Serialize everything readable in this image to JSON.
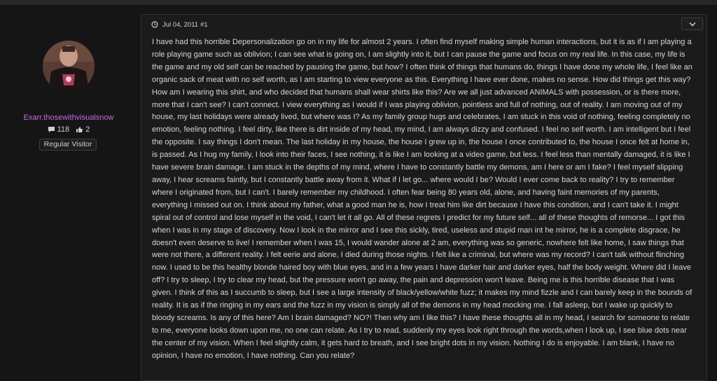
{
  "author": {
    "username": "Exarr.thosewithvisualsnow",
    "messages_count": "118",
    "likes_count": "2",
    "role": "Regular Visitor",
    "username_color": "#c56ae6"
  },
  "post": {
    "date": "Jul 04, 2011",
    "number": "#1",
    "body": "I have had this horrible Depersonalization go on in my life for almost 2 years. I often find myself making simple human interactions, but it is as if I am playing a role playing game such as oblivion; I can see what is going on, I am slightly into it, but I can pause the game and focus on my real life. In this case, my life is the game and my old self can be reached by pausing the game, but how? I often think of things that humans do, things I have done my whole life, I feel like an organic sack of meat with no self worth, as I am starting to view everyone as this. Everything I have ever done, makes no sense. How did things get this way? How am I wearing this shirt, and who decided that humans shall wear shirts like this? Are we all just advanced ANIMALS with possession, or is there more, more that I can't see? I can't connect. I view everything as I would if I was playing oblivion, pointless and full of nothing, out of reality. I am moving out of my house, my last holidays were already lived, but where was I? As my family group hugs and celebrates, I am stuck in this void of nothing, feeling completely no emotion, feeling nothing. I feel dirty, like there is dirt inside of my head, my mind, I am always dizzy and confused. I feel no self worth. I am intelligent but I feel the opposite. I say things I don't mean. The last holiday in my house, the house I grew up in, the house I once contributed to, the house I once felt at home in, is passed. As I hug my family, I look into their faces, I see nothing, it is like I am looking at a video game, but less. I feel less than mentally damaged, it is like I have severe brain damage. I am stuck in the depths of my mind, where I have to constantly battle my demons, am I here or am I fake? I feel myself slipping away, I hear screams faintly, but I constantly battle away from it. What if I let go... where would I be? Would I ever come back to reality? I try to remember where I originated from, but I can't. I barely remember my childhood. I often fear being 80 years old, alone, and having faint memories of my parents, everything I missed out on. I think about my father, what a good man he is, how I treat him like dirt because I have this condition, and I can't take it. I might spiral out of control and lose myself in the void, I can't let it all go. All of these regrets I predict for my future self... all of these thoughts of remorse... I got this when I was in my stage of discovery. Now I look in the mirror and I see this sickly, tired, useless and stupid man int he mirror, he is a complete disgrace, he doesn't even deserve to live! I remember when I was 15, I would wander alone at 2 am, everything was so generic, nowhere felt like home, I saw things that were not there, a different reality. I felt eerie and alone, I died during those nights. I felt like a criminal, but where was my record? I can't talk without flinching now. I used to be this healthy blonde haired boy with blue eyes, and in a few years I have darker hair and darker eyes, half the body weight. Where did I leave off? I try to sleep, I try to clear my head, but the pressure won't go away, the pain and depression won't leave. Being me is this horrible disease that I was given. I think of this as I succumb to sleep, but I see a large intensity of black/yellow/white fuzz; it makes my mind fizzle and I can barely keep in the bounds of reality. It is as if the ringing in my ears and the fuzz in my vision is simply all of the demons in my head mocking me. I fall asleep, but I wake up quickly to bloody screams. Is any of this here? Am I brain damaged? NO?! Then why am I like this? I have these thoughts all in my head, I search for someone to relate to me, everyone looks down upon me, no one can relate. As I try to read, suddenly my eyes look right through the words,when I look up, I see blue dots near the center of my vision. When I feel slightly calm, it gets hard to breath, and I see bright dots in my vision. Nothing I do is enjoyable. I am blank, I have no opinion, I have no emotion, I have nothing. Can you relate?"
  },
  "icons": {
    "clock": "clock-icon",
    "chevron": "chevron-down-icon",
    "messages": "speech-bubble-icon",
    "likes": "thumbs-up-icon"
  }
}
